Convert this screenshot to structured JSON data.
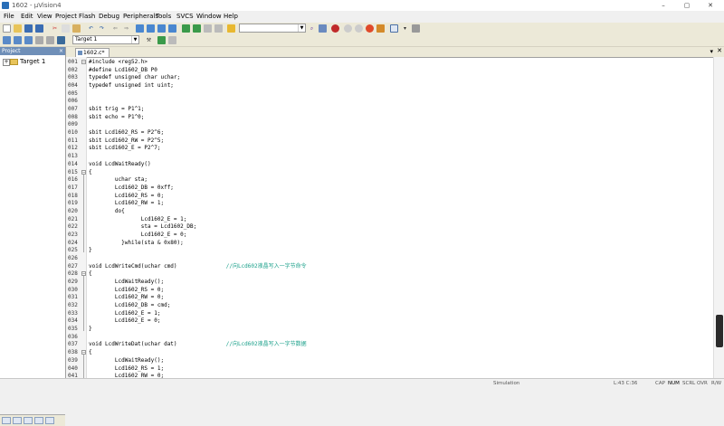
{
  "window": {
    "title": "1602 - µVision4",
    "minimize": "–",
    "maximize": "▢",
    "close": "✕"
  },
  "menu": [
    "File",
    "Edit",
    "View",
    "Project",
    "Flash",
    "Debug",
    "Peripherals",
    "Tools",
    "SVCS",
    "Window",
    "Help"
  ],
  "toolbar": {
    "target": "Target 1"
  },
  "project_panel": {
    "title": "Project",
    "close": "×",
    "tree_root": "Target 1",
    "expander": "+"
  },
  "editor": {
    "tab": "1602.c*",
    "lines": [
      {
        "n": "001",
        "t": "#include <reg52.h>",
        "f": "minus"
      },
      {
        "n": "002",
        "t": "#define Lcd1602_DB P0"
      },
      {
        "n": "003",
        "t": "typedef unsigned char uchar;"
      },
      {
        "n": "004",
        "t": "typedef unsigned int uint;"
      },
      {
        "n": "005",
        "t": ""
      },
      {
        "n": "006",
        "t": ""
      },
      {
        "n": "007",
        "t": "sbit trig = P1^1;"
      },
      {
        "n": "008",
        "t": "sbit echo = P1^0;"
      },
      {
        "n": "009",
        "t": ""
      },
      {
        "n": "010",
        "t": "sbit Lcd1602_RS = P2^6;"
      },
      {
        "n": "011",
        "t": "sbit Lcd1602_RW = P2^5;"
      },
      {
        "n": "012",
        "t": "sbit Lcd1602_E = P2^7;"
      },
      {
        "n": "013",
        "t": ""
      },
      {
        "n": "014",
        "t": "void LcdWaitReady()"
      },
      {
        "n": "015",
        "t": "{",
        "f": "minus"
      },
      {
        "n": "016",
        "t": "        uchar sta;"
      },
      {
        "n": "017",
        "t": "        Lcd1602_DB = 0xff;"
      },
      {
        "n": "018",
        "t": "        Lcd1602_RS = 0;"
      },
      {
        "n": "019",
        "t": "        Lcd1602_RW = 1;"
      },
      {
        "n": "020",
        "t": "        do{"
      },
      {
        "n": "021",
        "t": "                Lcd1602_E = 1;"
      },
      {
        "n": "022",
        "t": "                sta = Lcd1602_DB;"
      },
      {
        "n": "023",
        "t": "                Lcd1602_E = 0;"
      },
      {
        "n": "024",
        "t": "          }while(sta & 0x80);"
      },
      {
        "n": "025",
        "t": "}"
      },
      {
        "n": "026",
        "t": ""
      },
      {
        "n": "027",
        "t": "void LcdWriteCmd(uchar cmd)",
        "c": "               //向Lcd602液晶写入一字节命令"
      },
      {
        "n": "028",
        "t": "{",
        "f": "minus"
      },
      {
        "n": "029",
        "t": "        LcdWaitReady();"
      },
      {
        "n": "030",
        "t": "        Lcd1602_RS = 0;"
      },
      {
        "n": "031",
        "t": "        Lcd1602_RW = 0;"
      },
      {
        "n": "032",
        "t": "        Lcd1602_DB = cmd;"
      },
      {
        "n": "033",
        "t": "        Lcd1602_E = 1;"
      },
      {
        "n": "034",
        "t": "        Lcd1602_E = 0;"
      },
      {
        "n": "035",
        "t": "}"
      },
      {
        "n": "036",
        "t": ""
      },
      {
        "n": "037",
        "t": "void LcdWriteDat(uchar dat)",
        "c": "               //向Lcd602液晶写入一字节数据"
      },
      {
        "n": "038",
        "t": "{",
        "f": "minus"
      },
      {
        "n": "039",
        "t": "        LcdWaitReady();"
      },
      {
        "n": "040",
        "t": "        Lcd1602_RS = 1;"
      },
      {
        "n": "041",
        "t": "        Lcd1602_RW = 0;"
      }
    ]
  },
  "status": {
    "mode": "Simulation",
    "position": "L:43 C:36",
    "caps": "CAP",
    "num": "NUM",
    "scrl": "SCRL",
    "ovr": "OVR",
    "rw": "R/W"
  }
}
